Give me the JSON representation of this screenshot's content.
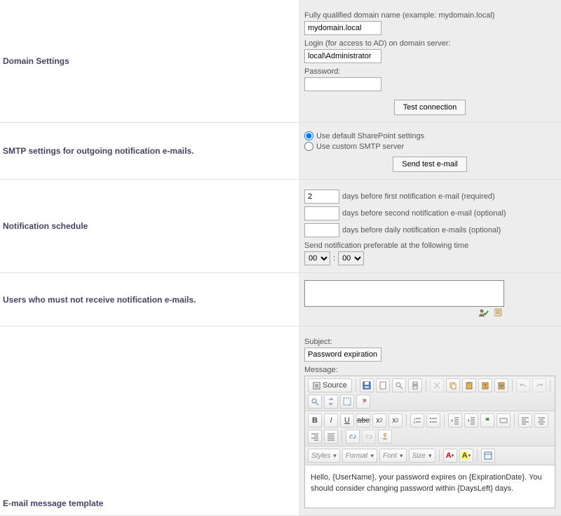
{
  "domain": {
    "heading": "Domain Settings",
    "fqdn_label": "Fully qualified domain name (example: mydomain.local)",
    "fqdn_value": "mydomain.local",
    "login_label": "Login (for access to AD) on domain server:",
    "login_value": "local\\Administrator",
    "password_label": "Password:",
    "password_value": "",
    "test_btn": "Test connection"
  },
  "smtp": {
    "heading": "SMTP settings for outgoing notification e-mails.",
    "opt_default": "Use default SharePoint settings",
    "opt_custom": "Use custom SMTP server",
    "selected": "default",
    "send_test_btn": "Send test e-mail"
  },
  "schedule": {
    "heading": "Notification schedule",
    "days_first": "2",
    "days_first_txt": "days before first notification e-mail (required)",
    "days_second": "",
    "days_second_txt": "days before second notification e-mail (optional)",
    "days_daily": "",
    "days_daily_txt": "days before daily notification e-mails (optional)",
    "time_label": "Send notification preferable at the following time",
    "time_hh": "00",
    "time_mm": "00"
  },
  "exclude": {
    "heading": "Users who must not receive notification e-mails.",
    "value": ""
  },
  "template": {
    "heading": "E-mail message template",
    "subject_label": "Subject:",
    "subject_value": "Password expiration",
    "message_label": "Message:",
    "source_btn": "Source",
    "styles_label": "Styles",
    "format_label": "Format",
    "font_label": "Font",
    "size_label": "Size",
    "body": "Hello, {UserName}, your password expires on {ExpirationDate}. You should consider changing password within {DaysLeft} days."
  }
}
